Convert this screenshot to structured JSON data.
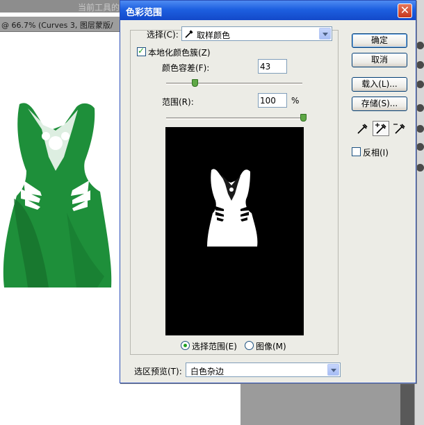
{
  "background": {
    "top_hint": "当前工具的",
    "doc_tab_title": "@ 66.7% (Curves 3, 图层蒙版/"
  },
  "dialog": {
    "title": "色彩范围",
    "select_label": "选择(C):",
    "select_value": "取样颜色",
    "localized_clusters_label": "本地化颜色簇(Z)",
    "localized_clusters_checked": true,
    "fuzziness_label": "颜色容差(F):",
    "fuzziness_value": "43",
    "fuzziness_fraction": 0.21,
    "range_label": "范围(R):",
    "range_value": "100",
    "range_unit": "%",
    "range_fraction": 1.0,
    "view_selection_label": "选择范围(E)",
    "view_image_label": "图像(M)",
    "view_selected": "selection",
    "preview_label": "选区预览(T):",
    "preview_value": "白色杂边",
    "buttons": {
      "ok": "确定",
      "cancel": "取消",
      "load": "载入(L)...",
      "save": "存储(S)..."
    },
    "invert_label": "反相(I)",
    "invert_checked": false,
    "eyedroppers": [
      "eyedropper-icon",
      "eyedropper-plus-icon",
      "eyedropper-minus-icon"
    ],
    "active_eyedropper": "eyedropper-plus-icon",
    "close_icon": "close-icon",
    "colors": {
      "title_bar": "#1d5fe0",
      "dress_green": "#1e8f3a",
      "slider_thumb": "#5fa846"
    }
  }
}
